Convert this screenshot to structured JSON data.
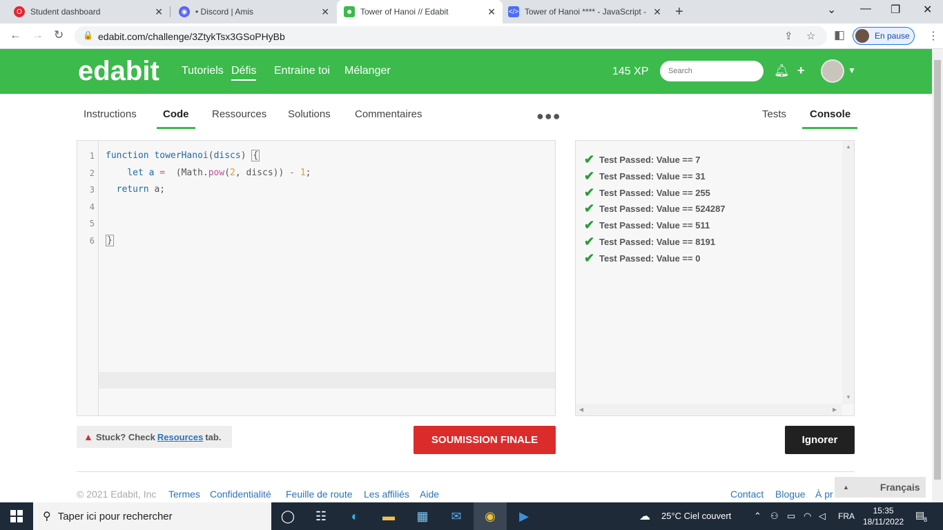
{
  "browser": {
    "tabs": [
      {
        "title": "Student dashboard",
        "icon": "opera-icon"
      },
      {
        "title": "• Discord | Amis",
        "icon": "discord-icon"
      },
      {
        "title": "Tower of Hanoi // Edabit",
        "icon": "edabit-icon",
        "active": true
      },
      {
        "title": "Tower of Hanoi **** - JavaScript -",
        "icon": "code-icon"
      }
    ],
    "url": "edabit.com/challenge/3ZtykTsx3GSoPHyBb",
    "profile_label": "En pause"
  },
  "header": {
    "logo": "edabit",
    "nav": [
      "Tutoriels",
      "Défis",
      "Entraine toi",
      "Mélanger"
    ],
    "xp": "145 XP",
    "search_placeholder": "Search"
  },
  "tabs_left": [
    "Instructions",
    "Code",
    "Ressources",
    "Solutions",
    "Commentaires"
  ],
  "tabs_right": [
    "Tests",
    "Console"
  ],
  "editor": {
    "line_numbers": [
      "1",
      "2",
      "3",
      "4",
      "5",
      "6"
    ]
  },
  "console": {
    "results": [
      "Test Passed: Value == 7",
      "Test Passed: Value == 31",
      "Test Passed: Value == 255",
      "Test Passed: Value == 524287",
      "Test Passed: Value == 511",
      "Test Passed: Value == 8191",
      "Test Passed: Value == 0"
    ]
  },
  "actions": {
    "stuck_prefix": "Stuck? Check",
    "stuck_link": "Resources",
    "stuck_suffix": "tab.",
    "submit": "SOUMISSION FINALE",
    "ignore": "Ignorer"
  },
  "footer": {
    "copyright": "© 2021 Edabit, Inc",
    "links": [
      "Termes",
      "Confidentialité",
      "Feuille de route",
      "Les affiliés",
      "Aide"
    ],
    "right_links": [
      "Contact",
      "Blogue",
      "À pr"
    ],
    "language": "Français"
  },
  "taskbar": {
    "search_placeholder": "Taper ici pour rechercher",
    "weather": "25°C  Ciel couvert",
    "lang": "FRA",
    "time": "15:35",
    "date": "18/11/2022",
    "notifications": "8"
  },
  "colors": {
    "brand_green": "#3cba4c",
    "submit_red": "#dc2b2b",
    "pass_green": "#2a9d3a"
  }
}
